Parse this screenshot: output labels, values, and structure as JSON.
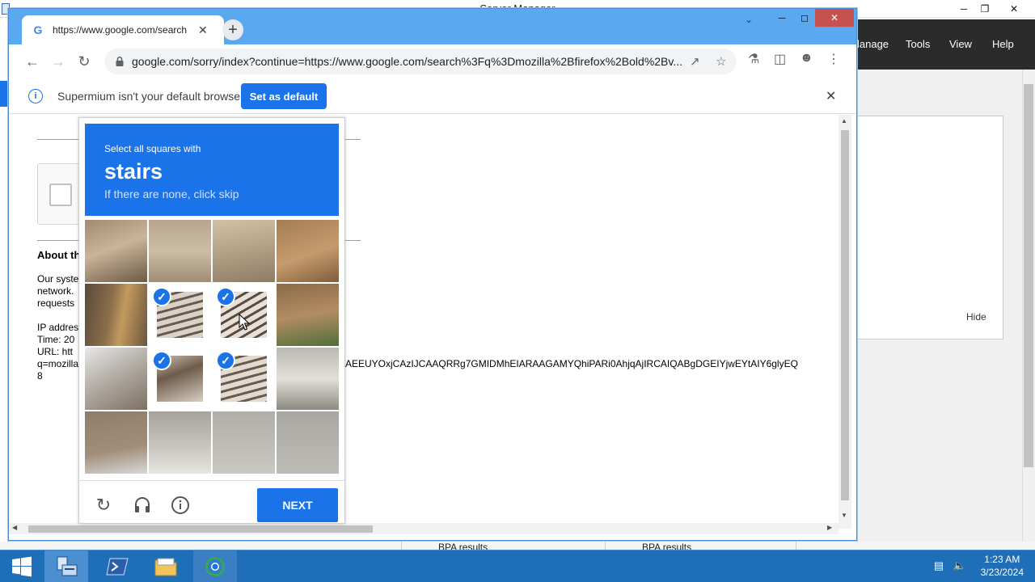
{
  "server_manager": {
    "title": "Server Manager",
    "menu": [
      "lanage",
      "Tools",
      "View",
      "Help"
    ],
    "hide_label": "Hide",
    "bpa": [
      "BPA results",
      "BPA results"
    ]
  },
  "browser": {
    "tab_title": "https://www.google.com/search",
    "url": "google.com/sorry/index?continue=https://www.google.com/search%3Fq%3Dmozilla%2Bfirefox%2Bold%2Bv...",
    "infobar": {
      "message": "Supermium isn't your default browser",
      "button": "Set as default"
    },
    "page": {
      "about_heading": "About th",
      "para1": [
        "Our syste",
        "network.",
        "requests"
      ],
      "para2": [
        "IP addres",
        "Time: 20",
        "URL: htt",
        "q=mozilla",
        "8"
      ],
      "url_tail": "AEEUYOxjCAzIJCAAQRRg7GMIDMhEIARAAGAMYQhiPARi0AhjqAjIRCAIQABgDGEIYjwEYtAIY6glyEQ"
    }
  },
  "captcha": {
    "instruction": "Select all squares with",
    "target": "stairs",
    "hint": "If there are none, click skip",
    "next": "NEXT",
    "selected_tiles": [
      5,
      6,
      9,
      10
    ],
    "accent": "#1a73e8"
  },
  "taskbar": {
    "time": "1:23 AM",
    "date": "3/23/2024"
  }
}
